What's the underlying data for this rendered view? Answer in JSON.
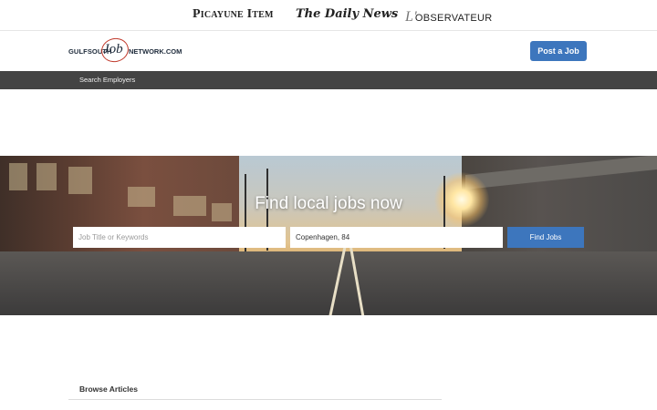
{
  "partners": [
    {
      "name": "Picayune Item"
    },
    {
      "name": "The Daily News"
    },
    {
      "name": "L'Observateur",
      "lead": "L'",
      "rest": "OBSERVATEUR"
    }
  ],
  "logo": {
    "left": "GULFSOUTH",
    "middle": "Job",
    "right": "NETWORK.COM"
  },
  "header": {
    "post_job_label": "Post a Job"
  },
  "nav": {
    "items": [
      {
        "label": "Search Employers"
      }
    ]
  },
  "hero": {
    "title": "Find local jobs now",
    "keyword_placeholder": "Job Title or Keywords",
    "keyword_value": "",
    "location_value": "Copenhagen, 84",
    "find_label": "Find Jobs"
  },
  "sections": {
    "browse_articles": "Browse Articles"
  },
  "colors": {
    "accent": "#3d76bd",
    "navbar": "#444444"
  }
}
